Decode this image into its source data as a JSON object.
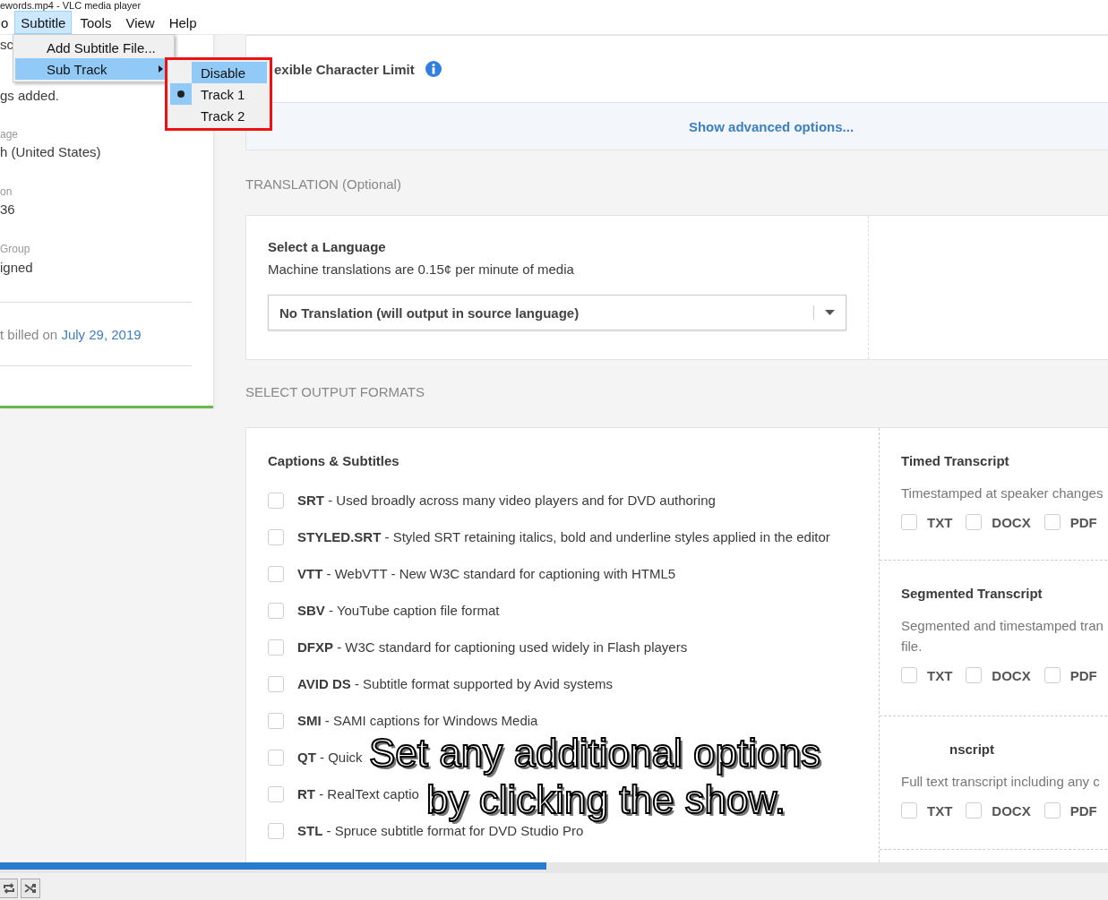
{
  "window": {
    "title": "ewords.mp4 - VLC media player"
  },
  "menu_bar": [
    {
      "label": "o",
      "selected": false
    },
    {
      "label": "Subtitle",
      "selected": true
    },
    {
      "label": "Tools",
      "selected": false
    },
    {
      "label": "View",
      "selected": false
    },
    {
      "label": "Help",
      "selected": false
    }
  ],
  "subtitle_menu": [
    {
      "label": "Add Subtitle File...",
      "highlighted": false,
      "has_submenu": false
    },
    {
      "label": "Sub Track",
      "highlighted": true,
      "has_submenu": true
    }
  ],
  "sub_track_menu": [
    {
      "label": "Disable",
      "highlighted": true,
      "checked": false
    },
    {
      "label": "Track 1",
      "highlighted": false,
      "checked": true
    },
    {
      "label": "Track 2",
      "highlighted": false,
      "checked": false
    }
  ],
  "video": {
    "sidebar": {
      "lines": [
        {
          "kind": "value",
          "text": "sc"
        },
        {
          "kind": "value",
          "text": "gs added."
        },
        {
          "kind": "label",
          "text": "age"
        },
        {
          "kind": "value",
          "text": "h (United States)"
        },
        {
          "kind": "label",
          "text": "on"
        },
        {
          "kind": "value",
          "text": "36"
        },
        {
          "kind": "label",
          "text": "Group"
        },
        {
          "kind": "value",
          "text": "igned"
        }
      ],
      "billing": {
        "text": "t billed on ",
        "link": "July 29, 2019"
      }
    },
    "character_limit": {
      "label": "exible Character Limit"
    },
    "advanced_link": "Show advanced options...",
    "translation": {
      "heading": "TRANSLATION (Optional)",
      "title": "Select a Language",
      "note": "Machine translations are 0.15¢ per minute of media",
      "select_value": "No Translation (will output in source language)"
    },
    "output_heading": "SELECT OUTPUT FORMATS",
    "captions": {
      "title": "Captions & Subtitles",
      "formats": [
        {
          "code": "SRT",
          "description": " - Used broadly across many video players and for DVD authoring",
          "checked": false
        },
        {
          "code": "STYLED.SRT",
          "description": " - Styled SRT retaining italics, bold and underline styles applied in the editor",
          "checked": false
        },
        {
          "code": "VTT",
          "description": " - WebVTT - New W3C standard for captioning with HTML5",
          "checked": false
        },
        {
          "code": "SBV",
          "description": " - YouTube caption file format",
          "checked": false
        },
        {
          "code": "DFXP",
          "description": " - W3C standard for captioning used widely in Flash players",
          "checked": false
        },
        {
          "code": "AVID DS",
          "description": " - Subtitle format supported by Avid systems",
          "checked": false
        },
        {
          "code": "SMI",
          "description": " - SAMI captions for Windows Media",
          "checked": false
        },
        {
          "code": "QT",
          "description": " - Quick",
          "checked": false
        },
        {
          "code": "RT",
          "description": " - RealText captio",
          "checked": false
        },
        {
          "code": "STL",
          "description": " - Spruce subtitle format for DVD Studio Pro",
          "checked": false
        }
      ]
    },
    "transcripts": [
      {
        "title": "Timed Transcript",
        "description": [
          "Timestamped at speaker changes"
        ],
        "formats": [
          {
            "label": "TXT",
            "checked": false
          },
          {
            "label": "DOCX",
            "checked": false
          },
          {
            "label": "PDF",
            "checked": false
          }
        ]
      },
      {
        "title": "Segmented Transcript",
        "description": [
          "Segmented and timestamped tran",
          "file."
        ],
        "formats": [
          {
            "label": "TXT",
            "checked": false
          },
          {
            "label": "DOCX",
            "checked": false
          },
          {
            "label": "PDF",
            "checked": false
          }
        ]
      },
      {
        "title": "nscript",
        "description": [
          "Full text transcript including any c"
        ],
        "formats": [
          {
            "label": "TXT",
            "checked": false
          },
          {
            "label": "DOCX",
            "checked": false
          },
          {
            "label": "PDF",
            "checked": false
          }
        ]
      }
    ],
    "subtitle_caption": [
      "Set any additional options",
      "by clicking the show."
    ]
  },
  "playback": {
    "level": 0.493
  }
}
